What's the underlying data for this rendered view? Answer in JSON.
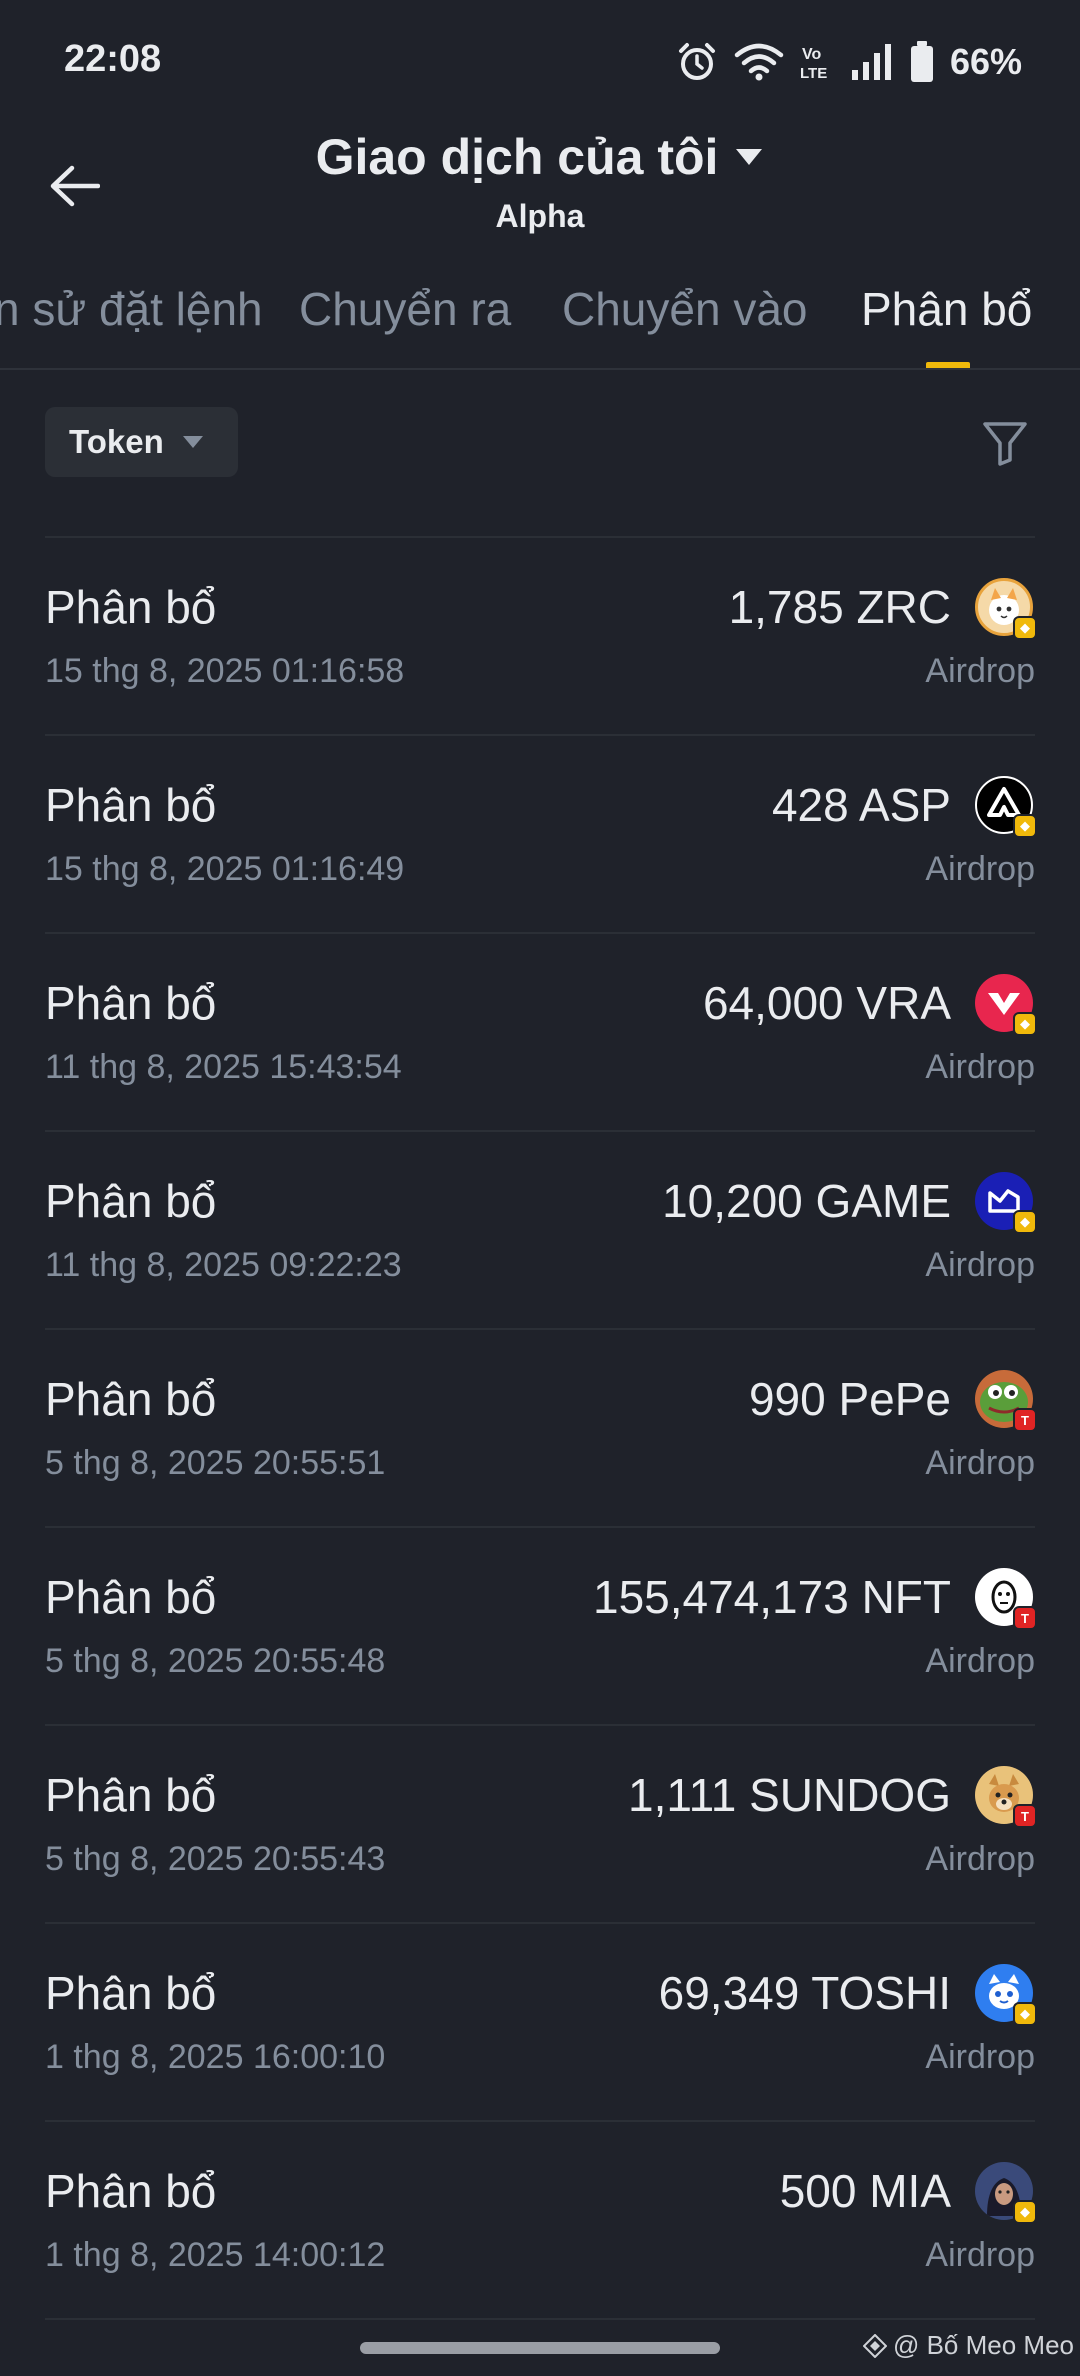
{
  "status_bar": {
    "time": "22:08",
    "battery": "66%",
    "icons": [
      "alarm-icon",
      "wifi-icon",
      "volte-icon",
      "signal-icon",
      "battery-icon"
    ]
  },
  "header": {
    "title": "Giao dịch của tôi",
    "subtitle": "Alpha"
  },
  "tabs": [
    {
      "label": "n sử đặt lệnh",
      "active": false
    },
    {
      "label": "Chuyển ra",
      "active": false
    },
    {
      "label": "Chuyển vào",
      "active": false
    },
    {
      "label": "Phân bổ",
      "active": true
    }
  ],
  "filter": {
    "token_label": "Token"
  },
  "rows": [
    {
      "title": "Phân bổ",
      "date": "15 thg 8, 2025 01:16:58",
      "amount": "1,785 ZRC",
      "type": "Airdrop",
      "icon": "zrc-token-icon"
    },
    {
      "title": "Phân bổ",
      "date": "15 thg 8, 2025 01:16:49",
      "amount": "428 ASP",
      "type": "Airdrop",
      "icon": "asp-token-icon"
    },
    {
      "title": "Phân bổ",
      "date": "11 thg 8, 2025 15:43:54",
      "amount": "64,000 VRA",
      "type": "Airdrop",
      "icon": "vra-token-icon"
    },
    {
      "title": "Phân bổ",
      "date": "11 thg 8, 2025 09:22:23",
      "amount": "10,200 GAME",
      "type": "Airdrop",
      "icon": "game-token-icon"
    },
    {
      "title": "Phân bổ",
      "date": "5 thg 8, 2025 20:55:51",
      "amount": "990 PePe",
      "type": "Airdrop",
      "icon": "pepe-token-icon"
    },
    {
      "title": "Phân bổ",
      "date": "5 thg 8, 2025 20:55:48",
      "amount": "155,474,173 NFT",
      "type": "Airdrop",
      "icon": "nft-token-icon"
    },
    {
      "title": "Phân bổ",
      "date": "5 thg 8, 2025 20:55:43",
      "amount": "1,111 SUNDOG",
      "type": "Airdrop",
      "icon": "sundog-token-icon"
    },
    {
      "title": "Phân bổ",
      "date": "1 thg 8, 2025 16:00:10",
      "amount": "69,349 TOSHI",
      "type": "Airdrop",
      "icon": "toshi-token-icon"
    },
    {
      "title": "Phân bổ",
      "date": "1 thg 8, 2025 14:00:12",
      "amount": "500 MIA",
      "type": "Airdrop",
      "icon": "mia-token-icon"
    }
  ],
  "watermark": "@ Bố Meo Meo",
  "colors": {
    "background": "#1f222a",
    "accent": "#f0b90b",
    "text_primary": "#eaecef",
    "text_secondary": "#848e9c"
  }
}
